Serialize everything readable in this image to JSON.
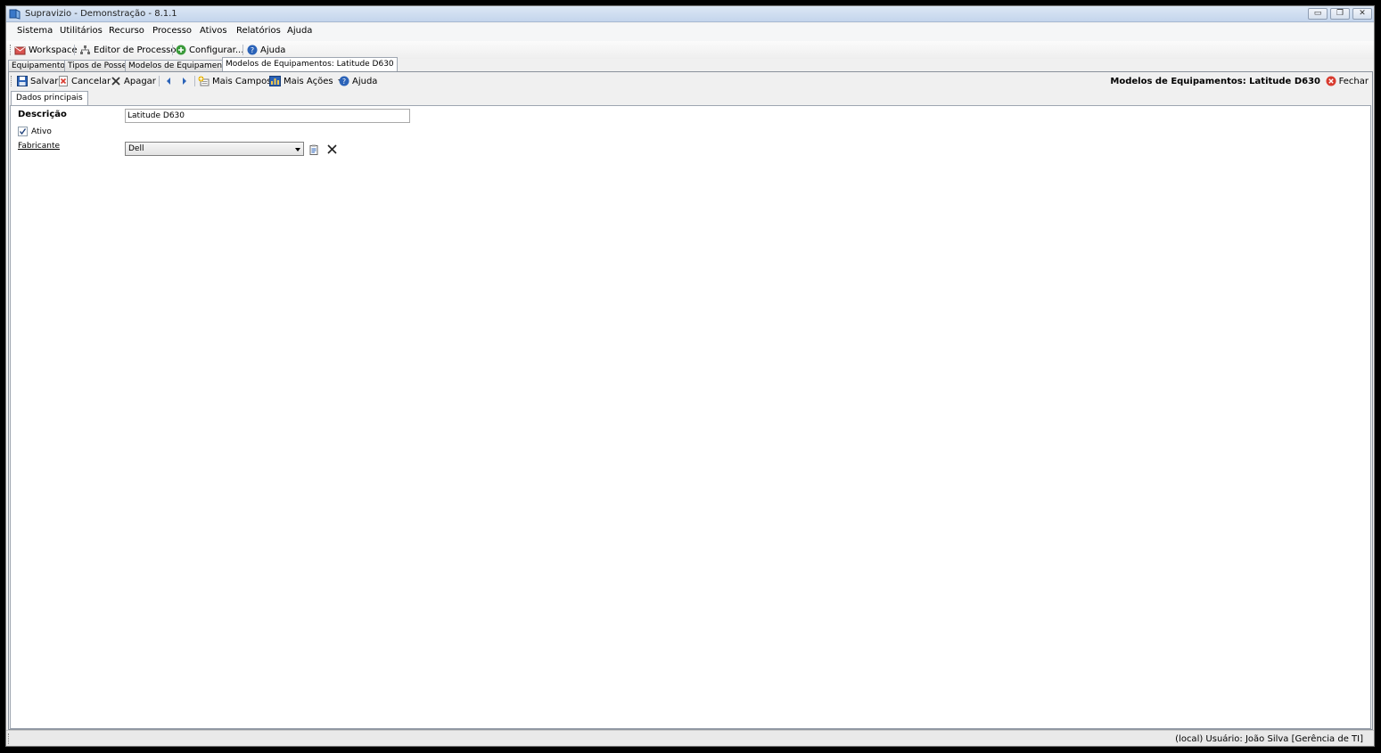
{
  "window": {
    "title": "Supravizio - Demonstração - 8.1.1",
    "minimize_label": "▭",
    "restore_label": "❐",
    "close_label": "✕"
  },
  "menu": [
    "Sistema",
    "Utilitários",
    "Recurso",
    "Processo",
    "Ativos",
    "Relatórios",
    "Ajuda"
  ],
  "main_toolbar": {
    "workspace": "Workspace",
    "editor_processos": "Editor de Processos",
    "configurar": "Configurar...",
    "ajuda": "Ajuda"
  },
  "doc_tabs": [
    "Equipamentos",
    "Tipos de Posse",
    "Modelos de Equipamentos",
    "Modelos de Equipamentos: Latitude D630"
  ],
  "form_toolbar": {
    "salvar": "Salvar",
    "cancelar": "Cancelar",
    "apagar": "Apagar",
    "mais_campos": "Mais Campos",
    "mais_acoes": "Mais Ações",
    "ajuda": "Ajuda",
    "form_title": "Modelos de Equipamentos: Latitude D630",
    "fechar": "Fechar"
  },
  "sub_tabs": [
    "Dados principais"
  ],
  "form": {
    "descricao_label": "Descrição",
    "descricao_value": "Latitude D630",
    "ativo_label": "Ativo",
    "ativo_checked": true,
    "fabricante_label": "Fabricante",
    "fabricante_value": "Dell"
  },
  "status": {
    "text": "(local)  Usuário: João Silva [Gerência de TI]"
  },
  "colors": {
    "accent_blue": "#2b63b8",
    "close_red": "#d83b2f",
    "add_green": "#3a9a3a"
  }
}
